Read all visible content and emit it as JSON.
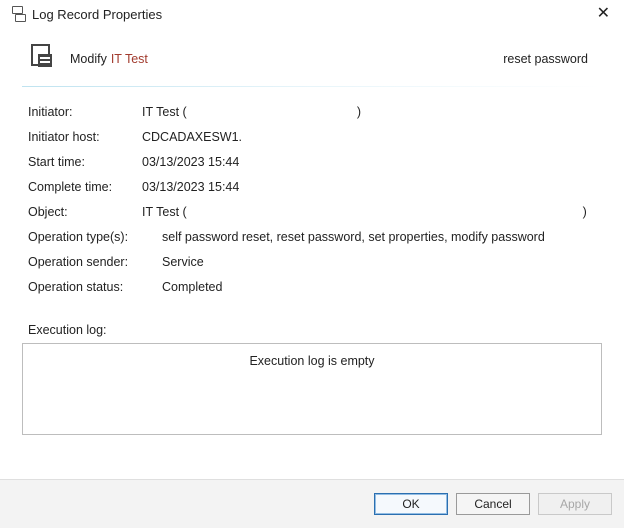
{
  "window": {
    "title": "Log Record Properties"
  },
  "header": {
    "action_word": "Modify",
    "target": "IT Test",
    "right_action": "reset password"
  },
  "fields": {
    "initiator": {
      "label": "Initiator:",
      "value": "IT Test (                                                 )"
    },
    "initiator_host": {
      "label": "Initiator host:",
      "value": "CDCADAXESW1."
    },
    "start_time": {
      "label": "Start time:",
      "value": "03/13/2023 15:44"
    },
    "complete_time": {
      "label": "Complete time:",
      "value": "03/13/2023 15:44"
    },
    "object": {
      "label": "Object:",
      "value": "IT Test (                                                                                                                  )"
    },
    "operation_types": {
      "label": "Operation type(s):",
      "value": "self password reset, reset password, set properties, modify password"
    },
    "operation_sender": {
      "label": "Operation sender:",
      "value": "Service"
    },
    "operation_status": {
      "label": "Operation status:",
      "value": "Completed"
    }
  },
  "execution_log": {
    "label": "Execution log:",
    "empty_text": "Execution log is empty"
  },
  "buttons": {
    "ok": "OK",
    "cancel": "Cancel",
    "apply": "Apply"
  }
}
